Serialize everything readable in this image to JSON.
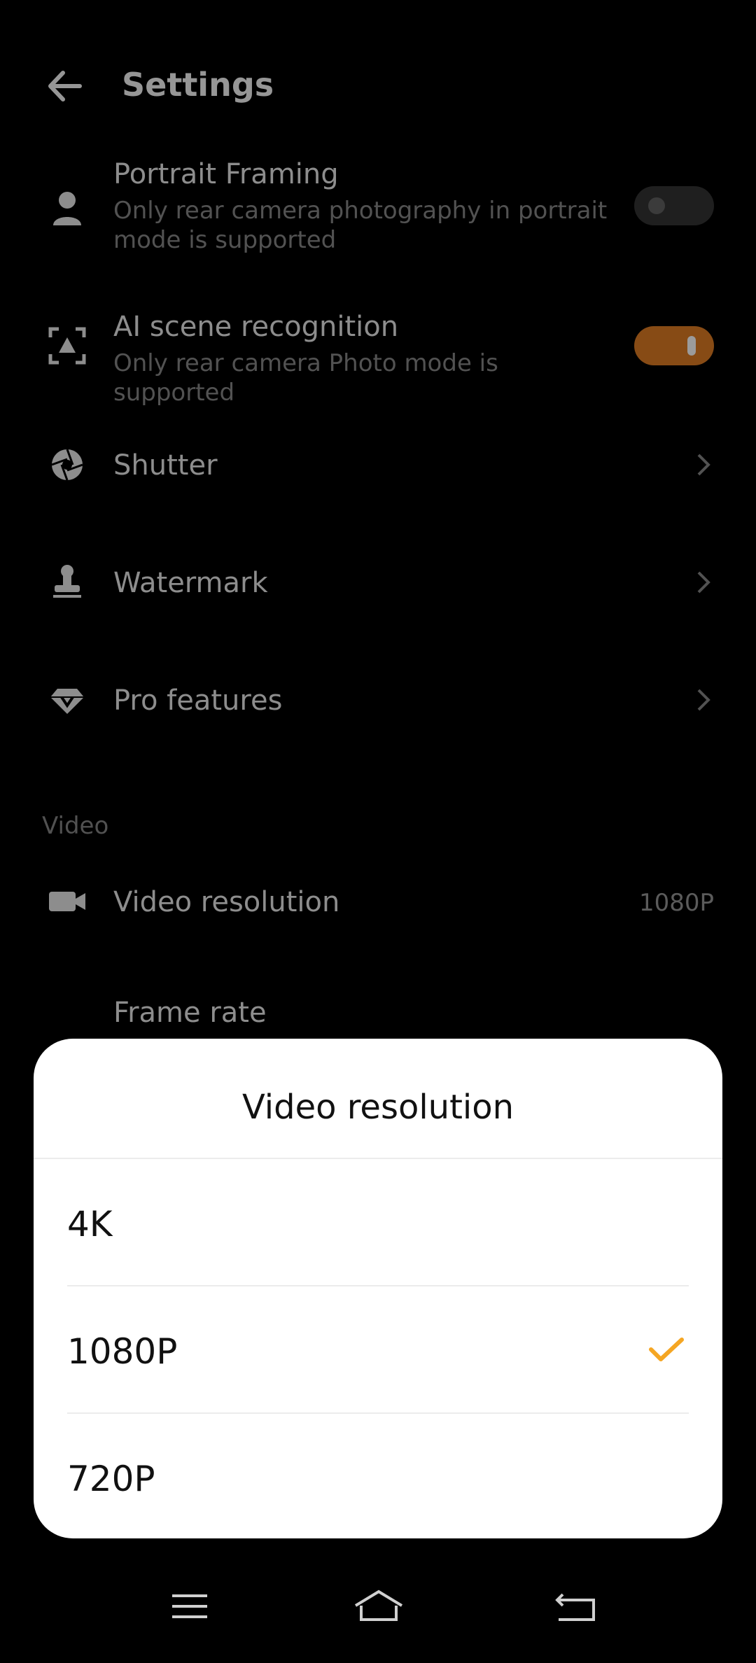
{
  "header": {
    "title": "Settings"
  },
  "settings": {
    "portrait_framing": {
      "title": "Portrait Framing",
      "subtitle": "Only rear camera photography in portrait mode is supported",
      "enabled": false
    },
    "ai_scene": {
      "title": "AI scene recognition",
      "subtitle": "Only rear camera Photo mode is supported",
      "enabled": true
    },
    "shutter": {
      "title": "Shutter"
    },
    "watermark": {
      "title": "Watermark"
    },
    "pro_features": {
      "title": "Pro features"
    },
    "video_section_label": "Video",
    "video_resolution": {
      "title": "Video resolution",
      "value": "1080P"
    },
    "frame_rate": {
      "title": "Frame rate"
    }
  },
  "dialog": {
    "title": "Video resolution",
    "options": [
      {
        "label": "4K",
        "selected": false
      },
      {
        "label": "1080P",
        "selected": true
      },
      {
        "label": "720P",
        "selected": false
      }
    ]
  },
  "colors": {
    "accent": "#b5651d",
    "check": "#f5a623"
  },
  "icons": {
    "back": "arrow-left-icon",
    "portrait": "person-icon",
    "ai_scene": "scan-scene-icon",
    "shutter": "aperture-icon",
    "watermark": "stamp-icon",
    "pro": "diamond-icon",
    "video": "video-camera-icon",
    "check": "checkmark-icon"
  }
}
